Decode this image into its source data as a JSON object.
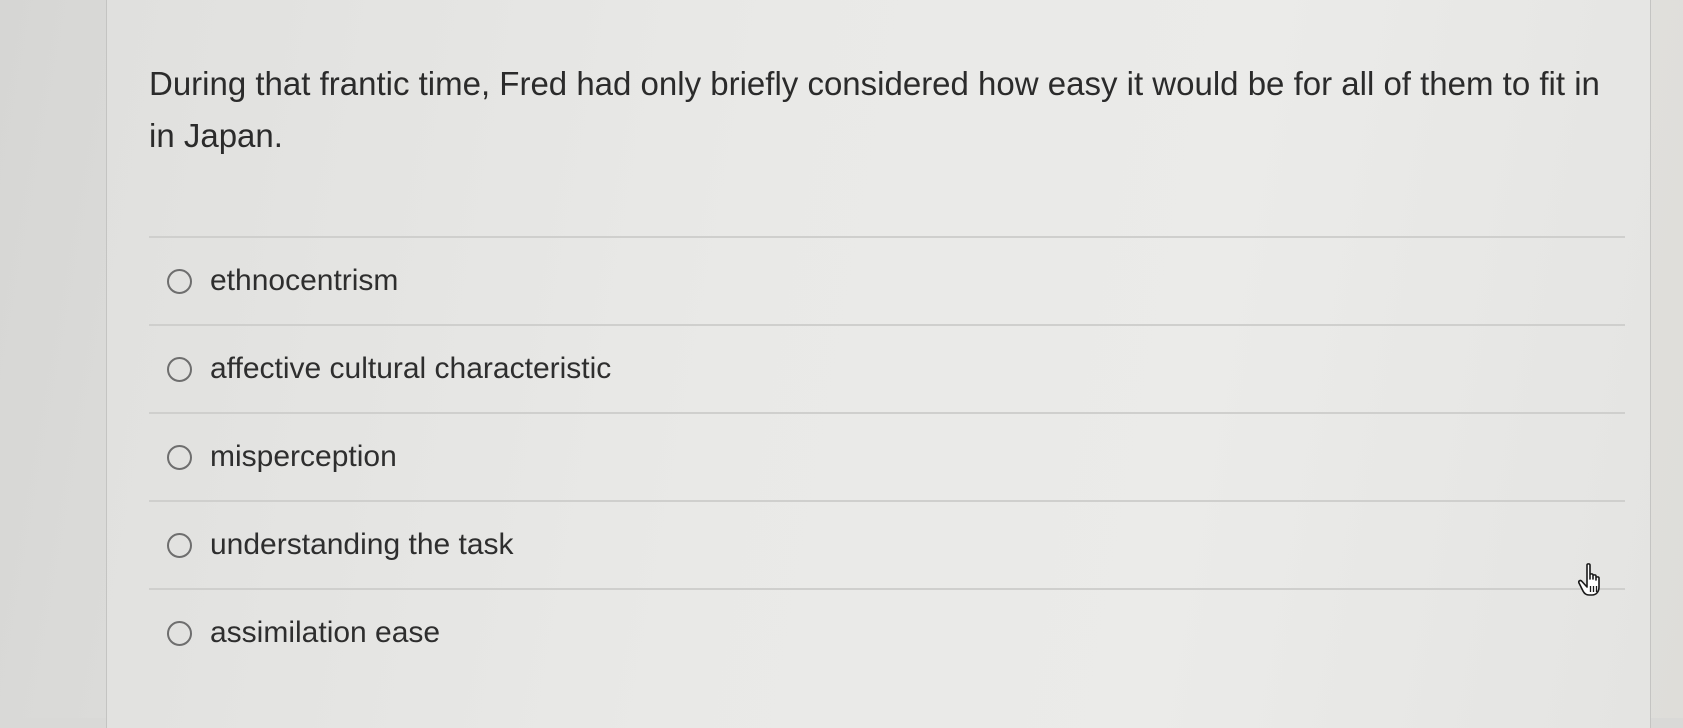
{
  "question": {
    "text": "During that frantic time, Fred had only briefly considered how easy it would be for all of them to fit in in Japan."
  },
  "options": [
    {
      "label": "ethnocentrism"
    },
    {
      "label": "affective cultural characteristic"
    },
    {
      "label": "misperception"
    },
    {
      "label": "understanding the task"
    },
    {
      "label": "assimilation ease"
    }
  ],
  "cursor": {
    "icon": "hand-pointer-icon"
  }
}
